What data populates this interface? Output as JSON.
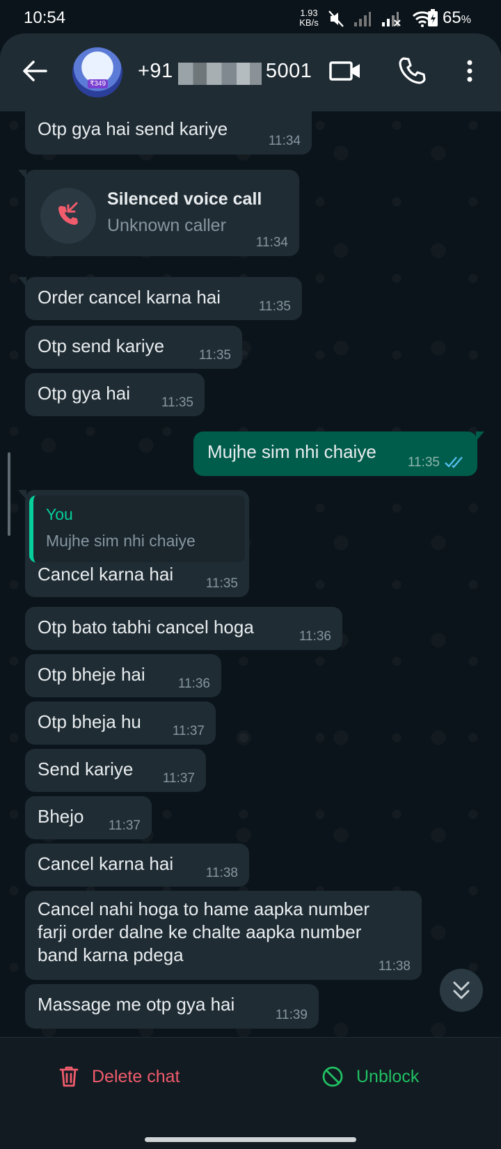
{
  "status_bar": {
    "time": "10:54",
    "net_speed_value": "1.93",
    "net_speed_unit": "KB/s",
    "battery_percent": "65",
    "battery_unit": "%",
    "icons": [
      "mute-icon",
      "signal-icon",
      "signal-x-icon",
      "wifi-icon",
      "battery-icon"
    ]
  },
  "header": {
    "number_prefix": "+91 8",
    "number_suffix": "5001",
    "avatar_price": "₹349",
    "icons": [
      "back-arrow-icon",
      "video-camera-icon",
      "phone-icon",
      "more-vert-icon"
    ]
  },
  "messages": [
    {
      "text": "Otp gya hai send kariye",
      "time": "11:34"
    },
    {
      "call_title": "Silenced voice call",
      "call_sub": "Unknown caller",
      "time": "11:34"
    },
    {
      "text": "Order cancel karna hai",
      "time": "11:35"
    },
    {
      "text": "Otp send kariye",
      "time": "11:35"
    },
    {
      "text": "Otp gya hai",
      "time": "11:35"
    },
    {
      "text": "Mujhe sim nhi chaiye",
      "time": "11:35",
      "outgoing": true
    },
    {
      "quote_author": "You",
      "quote_text": "Mujhe sim nhi chaiye",
      "text": "Cancel karna hai",
      "time": "11:35"
    },
    {
      "text": "Otp bato tabhi cancel hoga",
      "time": "11:36"
    },
    {
      "text": "Otp bheje hai",
      "time": "11:36"
    },
    {
      "text": "Otp bheja hu",
      "time": "11:37"
    },
    {
      "text": "Send kariye",
      "time": "11:37"
    },
    {
      "text": "Bhejo",
      "time": "11:37"
    },
    {
      "text": "Cancel karna hai",
      "time": "11:38"
    },
    {
      "lines": [
        "Cancel nahi hoga to hame aapka number",
        "farji order dalne ke chalte aapka number",
        "band karna pdega"
      ],
      "time": "11:38"
    },
    {
      "text": "Massage me otp gya hai",
      "time": "11:39"
    }
  ],
  "bottom": {
    "delete_label": "Delete chat",
    "unblock_label": "Unblock"
  },
  "colors": {
    "background": "#0b141a",
    "incoming_bubble": "#1f2c34",
    "outgoing_bubble": "#005c4b",
    "delete_red": "#f15c6d",
    "unblock_green": "#21c063",
    "read_tick_blue": "#53bdeb"
  }
}
